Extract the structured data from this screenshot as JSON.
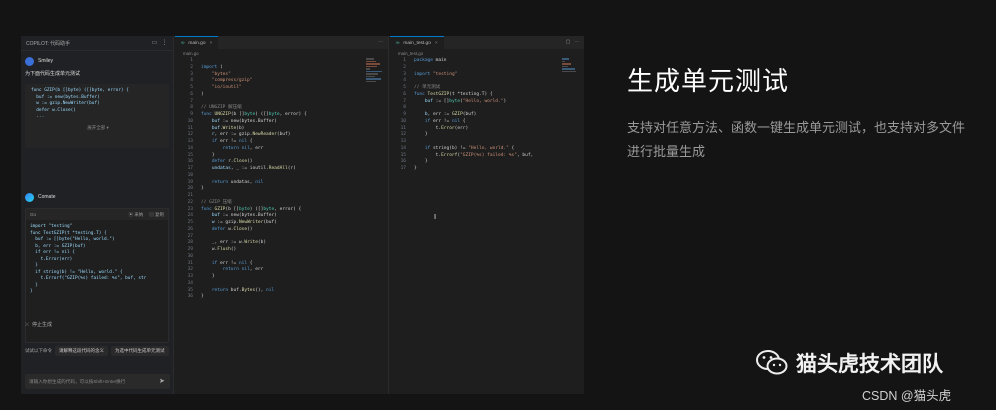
{
  "chat": {
    "header_title": "COPILOT: 代码助手",
    "user_name": "Smiley",
    "prompt": "为下面代码生成单元测试",
    "selected_code": [
      "func GZIP(b []byte) ([]byte, error) {",
      "  buf := new(bytes.Buffer)",
      "  w := gzip.NewWriter(buf)",
      "  defer w.Close()",
      "  ..."
    ],
    "more_label": "展开全部 ▾",
    "bot_name": "Comate",
    "bot_bar_left": "Go",
    "bot_action_insert": "采纳",
    "bot_action_copy": "复制",
    "bot_code": [
      "import \"testing\"",
      "",
      "",
      "func TestGZIP(t *testing.T) {",
      "  buf := []byte(\"Hello, world.\")",
      "",
      "  b, err := GZIP(buf)",
      "  if err != nil {",
      "    t.Error(err)",
      "  }",
      "",
      "  if string(b) != \"Hello, world.\" {",
      "    t.Errorf(\"GZIP(%s) failed: %s\", buf, str",
      "  }",
      "}"
    ],
    "stop_label": "停止生成",
    "chips_label": "试试以下命令",
    "chip_1": "请解释这段代码的含义",
    "chip_2": "为选中代码生成单元测试",
    "input_placeholder": "请输入你想生成的代码，可以按Shift+Enter换行"
  },
  "editor_left": {
    "tab_label": "main.go",
    "breadcrumb": "main.go",
    "lines": [
      {
        "n": "1",
        "segs": [
          [
            "",
            ""
          ]
        ]
      },
      {
        "n": "2",
        "segs": [
          [
            "kw",
            "import"
          ],
          [
            "pl",
            " ("
          ]
        ]
      },
      {
        "n": "3",
        "segs": [
          [
            "str",
            "    \"bytes\""
          ]
        ]
      },
      {
        "n": "4",
        "segs": [
          [
            "str",
            "    \"compress/gzip\""
          ]
        ]
      },
      {
        "n": "5",
        "segs": [
          [
            "str",
            "    \"io/ioutil\""
          ]
        ]
      },
      {
        "n": "6",
        "segs": [
          [
            "pl",
            ")"
          ]
        ]
      },
      {
        "n": "7",
        "segs": [
          [
            "",
            ""
          ]
        ]
      },
      {
        "n": "8",
        "segs": [
          [
            "cm",
            "// UNGZIP 解压缩"
          ]
        ]
      },
      {
        "n": "9",
        "segs": [
          [
            "kw",
            "func"
          ],
          [
            "fn",
            " UNGZIP"
          ],
          [
            "pl",
            "(b []"
          ],
          [
            "ty",
            "byte"
          ],
          [
            "pl",
            ") ([]"
          ],
          [
            "ty",
            "byte"
          ],
          [
            "pl",
            ", error) {"
          ]
        ]
      },
      {
        "n": "10",
        "segs": [
          [
            "id",
            "    buf"
          ],
          [
            "pl",
            " := new(bytes.Buffer)"
          ]
        ]
      },
      {
        "n": "11",
        "segs": [
          [
            "id",
            "    buf"
          ],
          [
            "fn",
            ".Write"
          ],
          [
            "pl",
            "(b)"
          ]
        ]
      },
      {
        "n": "12",
        "segs": [
          [
            "id",
            "    r"
          ],
          [
            "pl",
            ", err := gzip."
          ],
          [
            "fn",
            "NewReader"
          ],
          [
            "pl",
            "(buf)"
          ]
        ]
      },
      {
        "n": "13",
        "segs": [
          [
            "kw",
            "    if"
          ],
          [
            "pl",
            " err != "
          ],
          [
            "kw",
            "nil"
          ],
          [
            "pl",
            " {"
          ]
        ]
      },
      {
        "n": "14",
        "segs": [
          [
            "kw",
            "        return"
          ],
          [
            "kw",
            " nil"
          ],
          [
            "pl",
            ", err"
          ]
        ]
      },
      {
        "n": "15",
        "segs": [
          [
            "pl",
            "    }"
          ]
        ]
      },
      {
        "n": "16",
        "segs": [
          [
            "kw",
            "    defer"
          ],
          [
            "pl",
            " r."
          ],
          [
            "fn",
            "Close"
          ],
          [
            "pl",
            "()"
          ]
        ]
      },
      {
        "n": "17",
        "segs": [
          [
            "id",
            "    undatas"
          ],
          [
            "pl",
            ", _ := ioutil."
          ],
          [
            "fn",
            "ReadAll"
          ],
          [
            "pl",
            "(r)"
          ]
        ]
      },
      {
        "n": "18",
        "segs": [
          [
            "",
            ""
          ]
        ]
      },
      {
        "n": "19",
        "segs": [
          [
            "kw",
            "    return"
          ],
          [
            "pl",
            " undatas, "
          ],
          [
            "kw",
            "nil"
          ]
        ]
      },
      {
        "n": "20",
        "segs": [
          [
            "pl",
            "}"
          ]
        ]
      },
      {
        "n": "21",
        "segs": [
          [
            "",
            ""
          ]
        ]
      },
      {
        "n": "22",
        "segs": [
          [
            "cm",
            "// GZIP 压缩"
          ]
        ]
      },
      {
        "n": "23",
        "segs": [
          [
            "kw",
            "func"
          ],
          [
            "fn",
            " GZIP"
          ],
          [
            "pl",
            "(b []"
          ],
          [
            "ty",
            "byte"
          ],
          [
            "pl",
            ") ([]"
          ],
          [
            "ty",
            "byte"
          ],
          [
            "pl",
            ", error) {"
          ]
        ]
      },
      {
        "n": "24",
        "segs": [
          [
            "id",
            "    buf"
          ],
          [
            "pl",
            " := new(bytes.Buffer)"
          ]
        ]
      },
      {
        "n": "25",
        "segs": [
          [
            "id",
            "    w"
          ],
          [
            "pl",
            " := gzip."
          ],
          [
            "fn",
            "NewWriter"
          ],
          [
            "pl",
            "(buf)"
          ]
        ]
      },
      {
        "n": "26",
        "segs": [
          [
            "kw",
            "    defer"
          ],
          [
            "pl",
            " w."
          ],
          [
            "fn",
            "Close"
          ],
          [
            "pl",
            "()"
          ]
        ]
      },
      {
        "n": "27",
        "segs": [
          [
            "",
            ""
          ]
        ]
      },
      {
        "n": "28",
        "segs": [
          [
            "pl",
            "    _, err := w."
          ],
          [
            "fn",
            "Write"
          ],
          [
            "pl",
            "(b)"
          ]
        ]
      },
      {
        "n": "29",
        "segs": [
          [
            "pl",
            "    w."
          ],
          [
            "fn",
            "Flush"
          ],
          [
            "pl",
            "()"
          ]
        ]
      },
      {
        "n": "30",
        "segs": [
          [
            "",
            ""
          ]
        ]
      },
      {
        "n": "31",
        "segs": [
          [
            "kw",
            "    if"
          ],
          [
            "pl",
            " err != "
          ],
          [
            "kw",
            "nil"
          ],
          [
            "pl",
            " {"
          ]
        ]
      },
      {
        "n": "32",
        "segs": [
          [
            "kw",
            "        return"
          ],
          [
            "kw",
            " nil"
          ],
          [
            "pl",
            ", err"
          ]
        ]
      },
      {
        "n": "33",
        "segs": [
          [
            "pl",
            "    }"
          ]
        ]
      },
      {
        "n": "34",
        "segs": [
          [
            "",
            ""
          ]
        ]
      },
      {
        "n": "35",
        "segs": [
          [
            "kw",
            "    return"
          ],
          [
            "pl",
            " buf."
          ],
          [
            "fn",
            "Bytes"
          ],
          [
            "pl",
            "(), "
          ],
          [
            "kw",
            "nil"
          ]
        ]
      },
      {
        "n": "36",
        "segs": [
          [
            "pl",
            "}"
          ]
        ]
      }
    ]
  },
  "editor_right": {
    "tab_label": "main_test.go",
    "breadcrumb": "main_test.go",
    "lines": [
      {
        "n": "1",
        "segs": [
          [
            "kw",
            "package"
          ],
          [
            "pl",
            " main"
          ]
        ]
      },
      {
        "n": "2",
        "segs": [
          [
            "",
            ""
          ]
        ]
      },
      {
        "n": "3",
        "segs": [
          [
            "kw",
            "import"
          ],
          [
            "str",
            " \"testing\""
          ]
        ]
      },
      {
        "n": "4",
        "segs": [
          [
            "",
            ""
          ]
        ]
      },
      {
        "n": "5",
        "segs": [
          [
            "cm",
            "// 单元测试"
          ]
        ]
      },
      {
        "n": "6",
        "segs": [
          [
            "kw",
            "func"
          ],
          [
            "fn",
            " TestGZIP"
          ],
          [
            "pl",
            "(t *testing.T) {"
          ]
        ]
      },
      {
        "n": "7",
        "segs": [
          [
            "id",
            "    buf"
          ],
          [
            "pl",
            " := []"
          ],
          [
            "ty",
            "byte"
          ],
          [
            "pl",
            "("
          ],
          [
            "str",
            "\"Hello, world.\""
          ],
          [
            "pl",
            ")"
          ]
        ]
      },
      {
        "n": "8",
        "segs": [
          [
            "",
            ""
          ]
        ]
      },
      {
        "n": "9",
        "segs": [
          [
            "id",
            "    b"
          ],
          [
            "pl",
            ", err := "
          ],
          [
            "fn",
            "GZIP"
          ],
          [
            "pl",
            "(buf)"
          ]
        ]
      },
      {
        "n": "10",
        "segs": [
          [
            "kw",
            "    if"
          ],
          [
            "pl",
            " err != "
          ],
          [
            "kw",
            "nil"
          ],
          [
            "pl",
            " {"
          ]
        ]
      },
      {
        "n": "11",
        "segs": [
          [
            "pl",
            "        t."
          ],
          [
            "fn",
            "Error"
          ],
          [
            "pl",
            "(err)"
          ]
        ]
      },
      {
        "n": "12",
        "segs": [
          [
            "pl",
            "    }"
          ]
        ]
      },
      {
        "n": "13",
        "segs": [
          [
            "",
            ""
          ]
        ]
      },
      {
        "n": "14",
        "segs": [
          [
            "kw",
            "    if"
          ],
          [
            "pl",
            " string(b) != "
          ],
          [
            "str",
            "\"Hello, world.\""
          ],
          [
            "pl",
            " {"
          ]
        ]
      },
      {
        "n": "15",
        "segs": [
          [
            "pl",
            "        t."
          ],
          [
            "fn",
            "Errorf"
          ],
          [
            "pl",
            "("
          ],
          [
            "str",
            "\"GZIP(%s) failed: %s\""
          ],
          [
            "pl",
            ", buf, "
          ]
        ]
      },
      {
        "n": "16",
        "segs": [
          [
            "pl",
            "    }"
          ]
        ]
      },
      {
        "n": "17",
        "segs": [
          [
            "pl",
            "}"
          ]
        ]
      }
    ]
  },
  "hero": {
    "title": "生成单元测试",
    "description": "支持对任意方法、函数一键生成单元测试，也支持对多文件进行批量生成"
  },
  "brand": {
    "name": "猫头虎技术团队",
    "credit": "CSDN @猫头虎"
  }
}
